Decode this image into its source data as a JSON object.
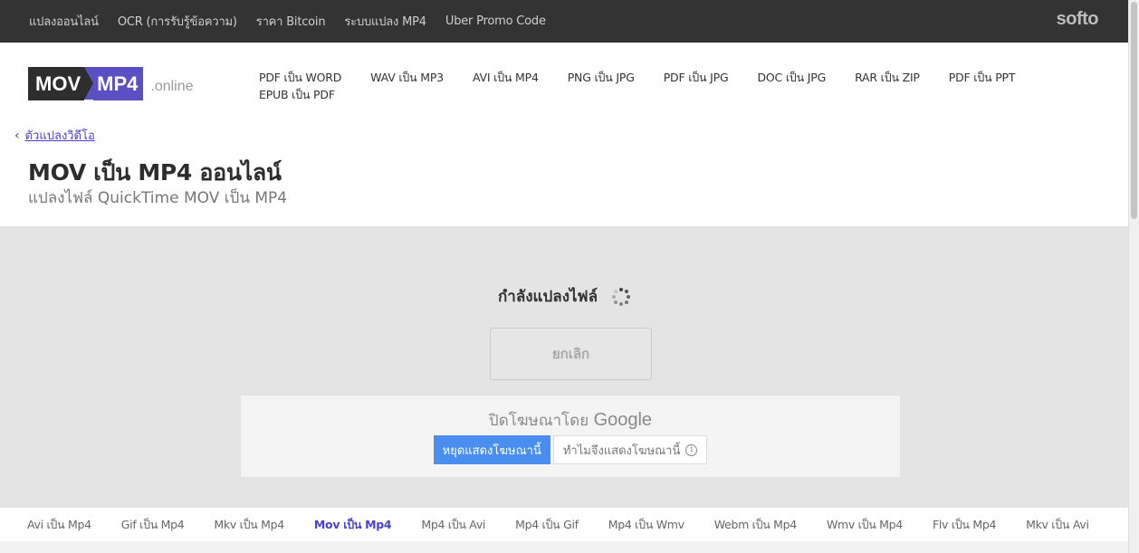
{
  "topbar": {
    "links": [
      "แปลงออนไลน์",
      "OCR (การรับรู้ข้อความ)",
      "ราคา Bitcoin",
      "ระบบแปลง MP4",
      "Uber Promo Code"
    ],
    "brand": "softo"
  },
  "header": {
    "logo": {
      "part1": "MOV",
      "part2": "MP4",
      "domain": ".online"
    },
    "nav": [
      "PDF เป็น WORD",
      "WAV เป็น MP3",
      "AVI เป็น MP4",
      "PNG เป็น JPG",
      "PDF เป็น JPG",
      "DOC เป็น JPG",
      "RAR เป็น ZIP",
      "PDF เป็น PPT",
      "EPUB เป็น PDF"
    ],
    "back_link": "ตัวแปลงวิดีโอ",
    "title": "MOV เป็น MP4 ออนไลน์",
    "subtitle": "แปลงไฟล์ QuickTime MOV เป็น MP4"
  },
  "main": {
    "status": "กำลังแปลงไฟล์",
    "cancel_label": "ยกเลิก",
    "ad": {
      "title_prefix": "ปิดโฆษณาโดย ",
      "title_brand": "Google",
      "stop_label": "หยุดแสดงโฆษณานี้",
      "why_label": "ทำไมจึงแสดงโฆษณานี้"
    }
  },
  "bottom_nav": {
    "items": [
      "Avi เป็น Mp4",
      "Gif เป็น Mp4",
      "Mkv เป็น Mp4",
      "Mov เป็น Mp4",
      "Mp4 เป็น Avi",
      "Mp4 เป็น Gif",
      "Mp4 เป็น Wmv",
      "Webm เป็น Mp4",
      "Wmv เป็น Mp4",
      "Flv เป็น Mp4",
      "Mkv เป็น Avi"
    ],
    "active_index": 3
  },
  "colors": {
    "accent": "#5b4fc4",
    "link": "#4a3fd1",
    "ad_button": "#4a8ef0",
    "topbar": "#333333"
  }
}
